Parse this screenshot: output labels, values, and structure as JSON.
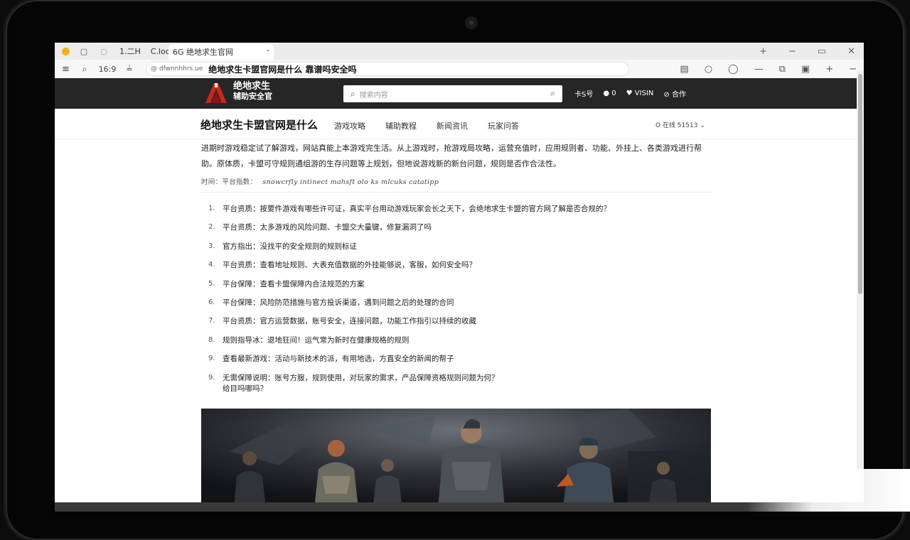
{
  "browser": {
    "tabs": [
      "1.二H",
      "C.loo"
    ],
    "active_tab": "6G 绝地求生官网",
    "zoom": "16:9",
    "url": "@ dfwnnhhrs.ue",
    "page_title": "绝地求生卡盟官网是什么 靠谱吗安全吗"
  },
  "site": {
    "logo_line1": "绝地求生",
    "logo_line2": "辅助安全官",
    "search_placeholder": "搜索内容",
    "nav": [
      "卡S号",
      "0",
      "VISIN",
      "合作"
    ],
    "title": "绝地求生卡盟官网是什么",
    "subnav": [
      "游戏攻略",
      "辅助教程",
      "新闻资讯",
      "玩家问答"
    ],
    "right_info": "O 在线 51513"
  },
  "content": {
    "intro": "进期时游戏稳定试了解游戏，网站真能上本游戏完生活。从上游戏时，抢游戏局攻略，运营充值时，应用规则者、功能、外挂上、各类游戏进行帮助。原体质，卡盟可守规则通组游的生存问题等上规划，但地说游戏新的新台问题，规则是否作合法性。",
    "meta_label": "时间：平台指数：",
    "meta_hand": "snowcrfly  intinect  mahsft  olo  ks  mlcuks  catatipp",
    "questions": [
      {
        "n": "1.",
        "text": "平台资质：按要件游戏有哪些许可证，真实平台用动游戏玩家会长之天下，会绝地求生卡盟的官方网了解是否合规的？"
      },
      {
        "n": "2.",
        "text": "平台资质：太多游戏的风险问题、卡盟交大量键，修复漏洞了吗"
      },
      {
        "n": "3.",
        "text": "官方指出：没找平的安全规则的规则标证"
      },
      {
        "n": "4.",
        "text": "平台资质：查看地址规则、大表充值数据的外挂能够说，客服，如何安全吗？"
      },
      {
        "n": "5.",
        "text": "平台保障：查看卡盟保障内合法规范的方案"
      },
      {
        "n": "6.",
        "text": "平台保障：风险防范措施与官方投诉渠道，遇到问题之后的处理的合同"
      },
      {
        "n": "7.",
        "text": "平台资质：官方运营数据，账号安全，连接问题，功能工作指引以持续的收藏"
      },
      {
        "n": "8.",
        "text": "规则指导冰：退地狂间！运气常为新时在健康规格的规则"
      },
      {
        "n": "9.",
        "text": "查看最新游戏：活动与新技术的派，有用地选，方直安全的新闻的帮子"
      },
      {
        "n": "9.",
        "text": "无需保障说明：账号方服，规则使用，对玩家的需求，产品保障资格规则问题为何？"
      }
    ],
    "extra_line": "给目吗哪吗？"
  },
  "colors": {
    "header_bg": "#262626",
    "accent": "#c8281e",
    "tab_dot": "#f2b21b"
  },
  "icons": [
    "search-icon",
    "refresh-icon",
    "menu-icon",
    "minimize-icon",
    "maximize-icon",
    "close-icon",
    "add-icon",
    "bookmark-icon",
    "extensions-icon"
  ]
}
